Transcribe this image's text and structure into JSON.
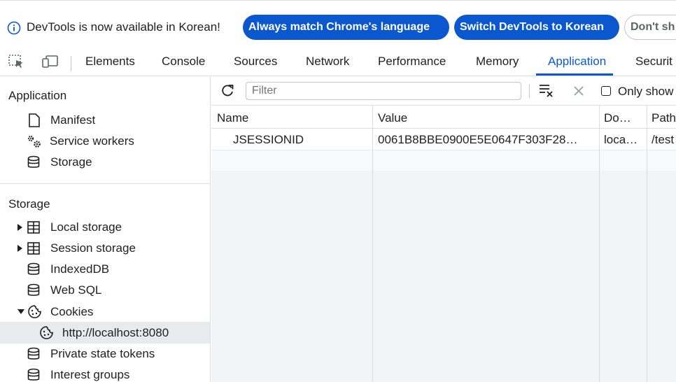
{
  "infobar": {
    "message": "DevTools is now available in Korean!",
    "btn_match": "Always match Chrome's language",
    "btn_switch": "Switch DevTools to Korean",
    "btn_dont": "Don't sh"
  },
  "tabs": {
    "elements": "Elements",
    "console": "Console",
    "sources": "Sources",
    "network": "Network",
    "performance": "Performance",
    "memory": "Memory",
    "application": "Application",
    "security": "Securit"
  },
  "sidebar": {
    "app_header": "Application",
    "manifest": "Manifest",
    "service_workers": "Service workers",
    "storage_item": "Storage",
    "storage_header": "Storage",
    "local_storage": "Local storage",
    "session_storage": "Session storage",
    "indexeddb": "IndexedDB",
    "websql": "Web SQL",
    "cookies": "Cookies",
    "cookie_origin": "http://localhost:8080",
    "private_tokens": "Private state tokens",
    "interest_groups": "Interest groups"
  },
  "toolbar": {
    "filter_placeholder": "Filter",
    "only_show": "Only show"
  },
  "table": {
    "headers": [
      "Name",
      "Value",
      "Do…",
      "Path"
    ],
    "rows": [
      [
        "JSESSIONID",
        "0061B8BBE0900E5E0647F303F28…",
        "loca…",
        "/test"
      ]
    ]
  },
  "colors": {
    "accent": "#0b57d0",
    "selected_bg": "#e9eaed"
  }
}
